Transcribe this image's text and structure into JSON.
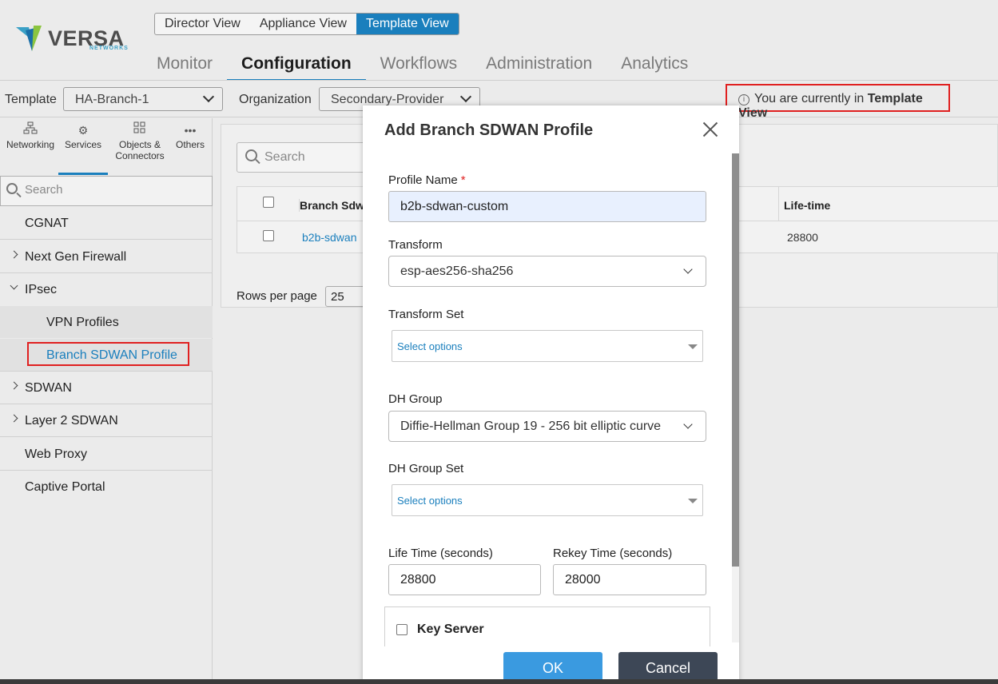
{
  "brand": {
    "name": "VERSA",
    "sub": "NETWORKS",
    "colors": {
      "accent": "#1a7fbd",
      "highlight_border": "#e02020",
      "ok_button": "#3a9ae0",
      "cancel_button": "#3d4756"
    }
  },
  "view_switch": {
    "items": [
      "Director View",
      "Appliance View",
      "Template View"
    ],
    "active": "Template View"
  },
  "main_nav": {
    "items": [
      "Monitor",
      "Configuration",
      "Workflows",
      "Administration",
      "Analytics"
    ],
    "active": "Configuration"
  },
  "template_bar": {
    "template_label": "Template",
    "template_value": "HA-Branch-1",
    "organization_label": "Organization",
    "organization_value": "Secondary-Provider",
    "notice_prefix": "You are currently in ",
    "notice_bold": "Template View"
  },
  "sidebar": {
    "tabs": [
      {
        "label": "Networking",
        "icon": "networking-icon"
      },
      {
        "label": "Services",
        "icon": "services-icon"
      },
      {
        "label": "Objects & Connectors",
        "icon": "objects-icon"
      },
      {
        "label": "Others",
        "icon": "others-icon"
      }
    ],
    "active_tab": "Services",
    "search_placeholder": "Search",
    "items": [
      {
        "label": "CGNAT",
        "expandable": false
      },
      {
        "label": "Next Gen Firewall",
        "expandable": true
      },
      {
        "label": "IPsec",
        "expandable": true,
        "expanded": true
      },
      {
        "label": "SDWAN",
        "expandable": true
      },
      {
        "label": "Layer 2 SDWAN",
        "expandable": true
      },
      {
        "label": "Web Proxy",
        "expandable": false
      },
      {
        "label": "Captive Portal",
        "expandable": false
      }
    ],
    "ipsec_children": [
      "VPN Profiles",
      "Branch SDWAN Profile"
    ],
    "active_child": "Branch SDWAN Profile"
  },
  "content": {
    "search_placeholder": "Search",
    "columns": [
      "Branch Sdwa",
      "Life-time"
    ],
    "rows": [
      {
        "name": "b2b-sdwan",
        "lifetime": "28800"
      }
    ],
    "rows_per_page_label": "Rows per page",
    "rows_per_page_value": "25"
  },
  "modal": {
    "title": "Add Branch SDWAN Profile",
    "profile_name_label": "Profile Name",
    "profile_name_required": "*",
    "profile_name_value": "b2b-sdwan-custom",
    "transform_label": "Transform",
    "transform_value": "esp-aes256-sha256",
    "transform_set_label": "Transform Set",
    "transform_set_placeholder": "Select options",
    "dh_group_label": "DH Group",
    "dh_group_value": "Diffie-Hellman Group 19 - 256 bit elliptic curve",
    "dh_group_set_label": "DH Group Set",
    "dh_group_set_placeholder": "Select options",
    "life_time_label": "Life Time (seconds)",
    "life_time_value": "28800",
    "rekey_time_label": "Rekey Time (seconds)",
    "rekey_time_value": "28000",
    "key_server_label": "Key Server",
    "key_server_checked": false,
    "ok_label": "OK",
    "cancel_label": "Cancel"
  }
}
